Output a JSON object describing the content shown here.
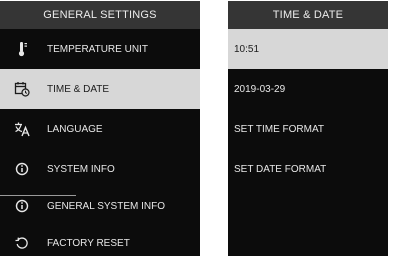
{
  "left_panel": {
    "title": "GENERAL SETTINGS",
    "items": [
      {
        "label": "TEMPERATURE UNIT",
        "icon": "thermometer-icon"
      },
      {
        "label": "TIME & DATE",
        "icon": "calendar-clock-icon",
        "selected": true
      },
      {
        "label": "LANGUAGE",
        "icon": "translate-icon"
      },
      {
        "label": "SYSTEM INFO",
        "icon": "info-icon"
      },
      {
        "label": "GENERAL SYSTEM INFO",
        "icon": "info-icon"
      },
      {
        "label": "FACTORY RESET",
        "icon": "reset-icon"
      }
    ]
  },
  "right_panel": {
    "title": "TIME & DATE",
    "items": [
      {
        "label": "10:51",
        "selected": true
      },
      {
        "label": "2019-03-29"
      },
      {
        "label": "SET TIME FORMAT"
      },
      {
        "label": "SET DATE FORMAT"
      }
    ]
  },
  "colors": {
    "background": "#0c0c0c",
    "header": "#353535",
    "selected": "#d7d7d7",
    "text": "#e8e8e8"
  }
}
